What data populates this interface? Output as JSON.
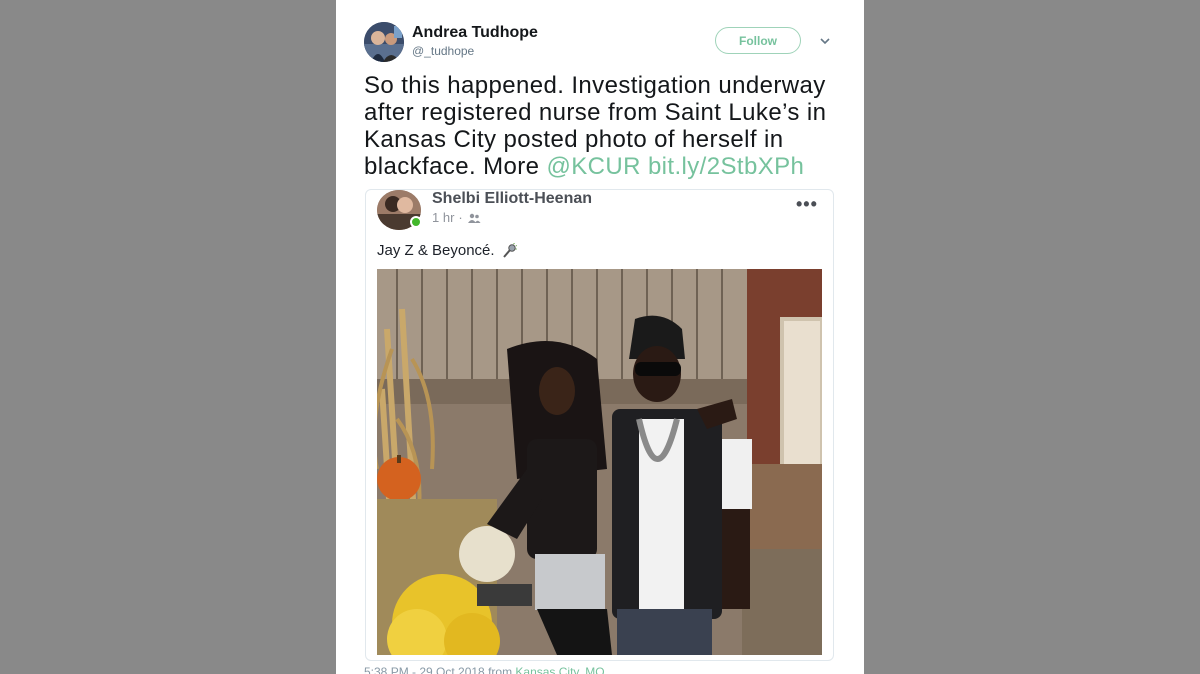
{
  "tweet": {
    "author_name": "Andrea Tudhope",
    "author_handle": "@_tudhope",
    "follow_label": "Follow",
    "text_before": "So this happened. Investigation underway after registered nurse from Saint Luke’s in Kansas City posted photo of herself in blackface. More ",
    "mention": "@KCUR",
    "link": "bit.ly/2StbXPh",
    "timestamp": "5:38 PM - 29 Oct 2018 from ",
    "location": "Kansas City, MO"
  },
  "embed": {
    "poster_name": "Shelbi Elliott-Heenan",
    "post_time": "1 hr",
    "time_separator": "·",
    "caption": "Jay Z & Beyoncé.",
    "more_label": "•••",
    "caption_icon": "microphone-icon",
    "audience_icon": "friends-icon"
  },
  "colors": {
    "accent": "#76c29d",
    "follow_border": "#9fd3b9",
    "background": "#898989",
    "online": "#42b72a"
  }
}
